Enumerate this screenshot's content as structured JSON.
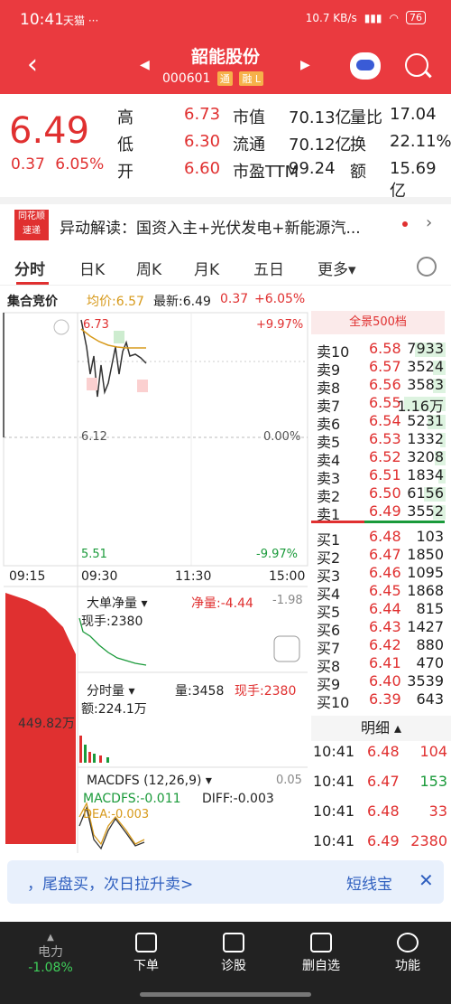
{
  "status": {
    "time": "10:41",
    "net": "10.7 KB/s",
    "battery": "76",
    "apps": "天猫 ···"
  },
  "nav": {
    "title": "韶能股份",
    "code": "000601",
    "tag1": "通",
    "tag2": "融 L"
  },
  "quote": {
    "price": "6.49",
    "change": "0.37",
    "pct": "6.05%",
    "rows": [
      {
        "l1": "高",
        "v1": "6.73",
        "l2": "市值",
        "v2": "70.13亿",
        "l3": "量比",
        "v3": "17.04"
      },
      {
        "l1": "低",
        "v1": "6.30",
        "l2": "流通",
        "v2": "70.12亿",
        "l3": "换",
        "v3": "22.11%"
      },
      {
        "l1": "开",
        "v1": "6.60",
        "l2": "市盈TTM",
        "v2": "99.24",
        "l3": "额",
        "v3": "15.69亿"
      }
    ]
  },
  "news": {
    "logo": "同花顺 速递",
    "text": "异动解读：国资入主+光伏发电+新能源汽..."
  },
  "tabs": [
    "分时",
    "日K",
    "周K",
    "月K",
    "五日",
    "更多▾"
  ],
  "chart_header": {
    "auction": "集合竞价",
    "avg": "均价:6.57",
    "latest": "最新:6.49",
    "chg": "0.37",
    "pct": "+6.05%"
  },
  "chart_labels": {
    "top_price": "6.73",
    "mid_price": "6.12",
    "bot_price": "5.51",
    "top_pct": "+9.97%",
    "mid_pct": "0.00%",
    "bot_pct": "-9.97%",
    "t1": "09:15",
    "t2": "09:30",
    "t3": "11:30",
    "t4": "15:00",
    "auction_vol": "449.82万",
    "big_title": "大单净量 ▾",
    "big_net": "净量:-4.44",
    "big_v": "-1.98",
    "big_now": "现手:2380",
    "vol_title": "分时量 ▾",
    "vol_amount": "量:3458",
    "vol_now": "现手:2380",
    "vol_amt": "额:224.1万",
    "macd_title": "MACDFS (12,26,9) ▾",
    "macd_v": "0.05",
    "macd_line": "MACDFS:-0.011",
    "diff": "DIFF:-0.003",
    "dea": "DEA:-0.003"
  },
  "book": {
    "head": "全景500档",
    "sell": [
      {
        "lab": "卖10",
        "pr": "6.58",
        "vol": "7933",
        "w": 34
      },
      {
        "lab": "卖9",
        "pr": "6.57",
        "vol": "3524",
        "w": 14
      },
      {
        "lab": "卖8",
        "pr": "6.56",
        "vol": "3583",
        "w": 14
      },
      {
        "lab": "卖7",
        "pr": "6.55",
        "vol": "1.16万",
        "w": 46
      },
      {
        "lab": "卖6",
        "pr": "6.54",
        "vol": "5231",
        "w": 20
      },
      {
        "lab": "卖5",
        "pr": "6.53",
        "vol": "1332",
        "w": 6
      },
      {
        "lab": "卖4",
        "pr": "6.52",
        "vol": "3208",
        "w": 12
      },
      {
        "lab": "卖3",
        "pr": "6.51",
        "vol": "1834",
        "w": 8
      },
      {
        "lab": "卖2",
        "pr": "6.50",
        "vol": "6156",
        "w": 24
      },
      {
        "lab": "卖1",
        "pr": "6.49",
        "vol": "3552",
        "w": 14
      }
    ],
    "buy": [
      {
        "lab": "买1",
        "pr": "6.48",
        "vol": "103"
      },
      {
        "lab": "买2",
        "pr": "6.47",
        "vol": "1850"
      },
      {
        "lab": "买3",
        "pr": "6.46",
        "vol": "1095"
      },
      {
        "lab": "买4",
        "pr": "6.45",
        "vol": "1868"
      },
      {
        "lab": "买5",
        "pr": "6.44",
        "vol": "815"
      },
      {
        "lab": "买6",
        "pr": "6.43",
        "vol": "1427"
      },
      {
        "lab": "买7",
        "pr": "6.42",
        "vol": "880"
      },
      {
        "lab": "买8",
        "pr": "6.41",
        "vol": "470"
      },
      {
        "lab": "买9",
        "pr": "6.40",
        "vol": "3539"
      },
      {
        "lab": "买10",
        "pr": "6.39",
        "vol": "643"
      }
    ],
    "detail_title": "明细 ▴",
    "trades": [
      {
        "t": "10:41",
        "p": "6.48",
        "v": "104",
        "c": "red"
      },
      {
        "t": "10:41",
        "p": "6.47",
        "v": "153",
        "c": "green"
      },
      {
        "t": "10:41",
        "p": "6.48",
        "v": "33",
        "c": "red"
      },
      {
        "t": "10:41",
        "p": "6.49",
        "v": "2380",
        "c": "red"
      }
    ]
  },
  "banner": {
    "text": "，尾盘买，次日拉升卖>",
    "right": "短线宝",
    "close": "✕"
  },
  "bottom": {
    "items": [
      {
        "label": "电力",
        "sub": "-1.08%"
      },
      {
        "label": "下单"
      },
      {
        "label": "诊股"
      },
      {
        "label": "删自选"
      },
      {
        "label": "功能"
      }
    ]
  },
  "colors": {
    "accent": "#ea3a3f",
    "up": "#e03030",
    "down": "#1a9a3a"
  }
}
